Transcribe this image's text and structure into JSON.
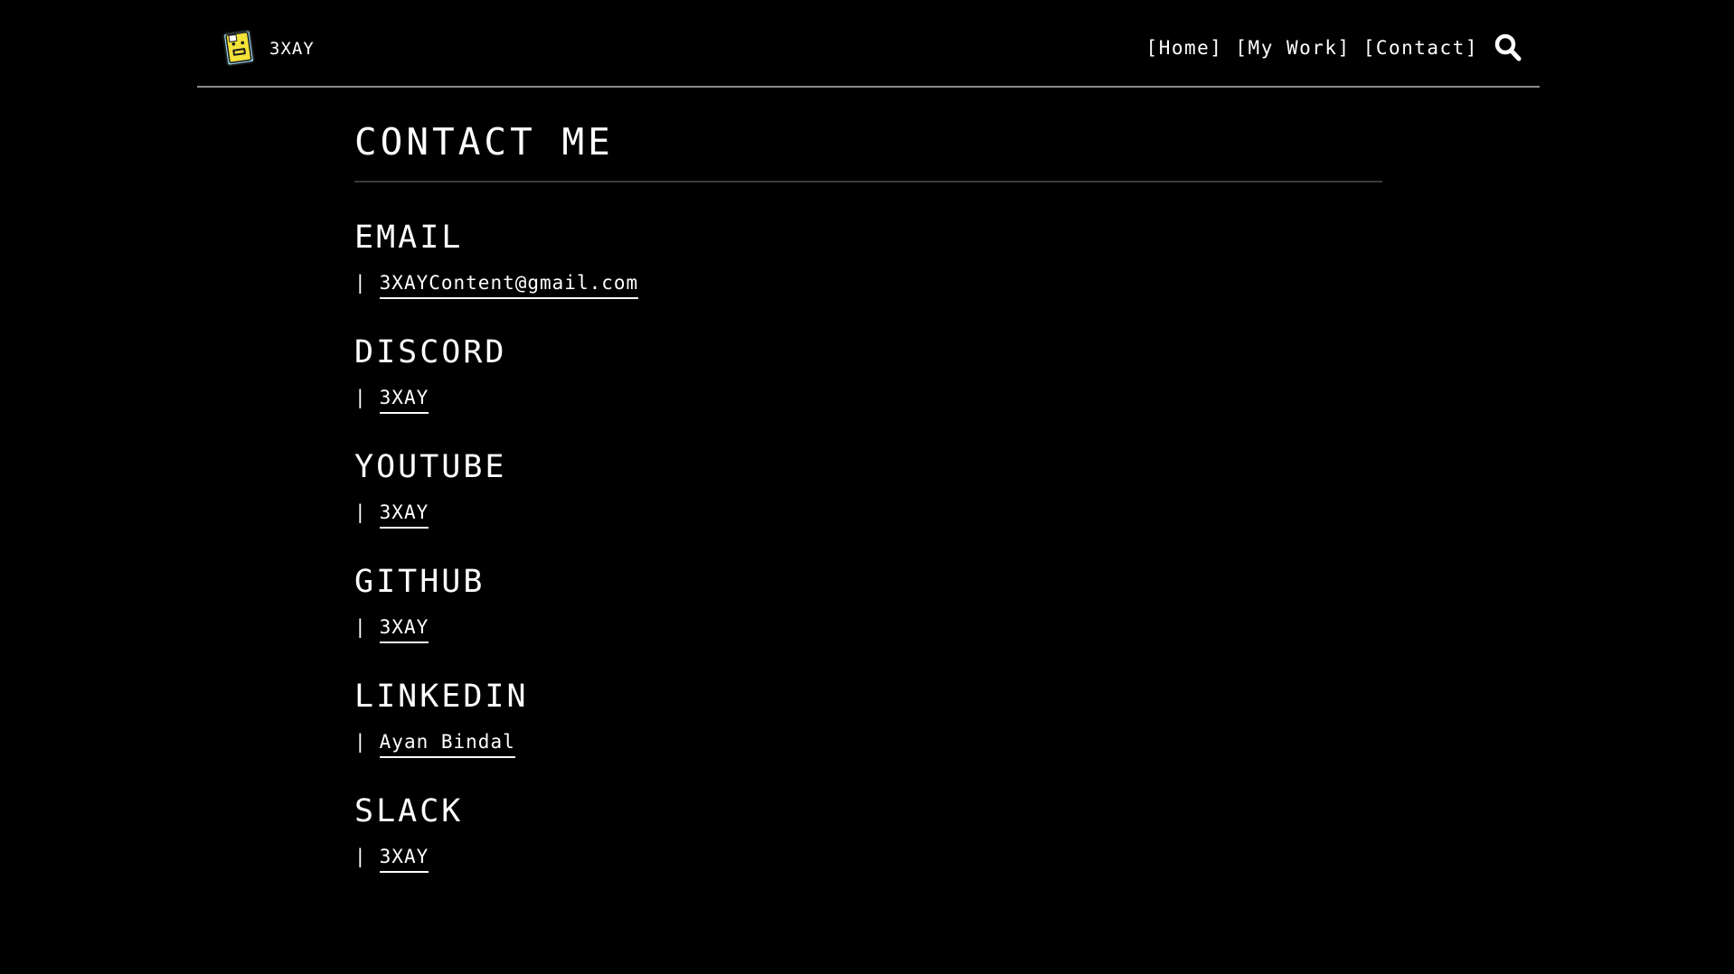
{
  "header": {
    "brand": "3XAY",
    "nav": [
      "[Home]",
      "[My Work]",
      "[Contact]"
    ],
    "search_icon": "search-icon",
    "logo_icon": "floppy-face-logo-icon"
  },
  "main": {
    "title": "CONTACT ME",
    "sections": [
      {
        "heading": "EMAIL",
        "pipe": "|",
        "link": "3XAYContent@gmail.com"
      },
      {
        "heading": "DISCORD",
        "pipe": "|",
        "link": "3XAY"
      },
      {
        "heading": "YOUTUBE",
        "pipe": "|",
        "link": "3XAY"
      },
      {
        "heading": "GITHUB",
        "pipe": "|",
        "link": "3XAY"
      },
      {
        "heading": "LINKEDIN",
        "pipe": "|",
        "link": "Ayan Bindal"
      },
      {
        "heading": "SLACK",
        "pipe": "|",
        "link": "3XAY"
      }
    ]
  },
  "colors": {
    "background": "#000000",
    "text": "#ffffff",
    "header_rule": "#8a8a8a",
    "title_rule": "#3a3a3a",
    "logo_yellow": "#f2e23a",
    "logo_blue": "#8fd0e6"
  }
}
